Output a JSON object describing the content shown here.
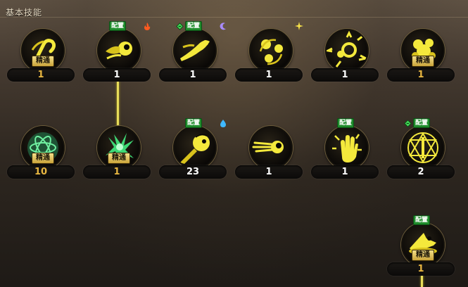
{
  "panel": {
    "title": "基本技能"
  },
  "labels": {
    "mastery": "精通",
    "equip": "配置"
  },
  "colors": {
    "level_gold": "#e9b741",
    "level_white": "#ffffff",
    "equip_badge": "#1f8c2c",
    "connector": "#e8dd5a"
  },
  "skills": [
    {
      "level": "1",
      "gold": true,
      "mastery": true,
      "equip": false,
      "cmd": false,
      "elem": null,
      "icon": "hand-spiral-icon"
    },
    {
      "level": "1",
      "gold": false,
      "mastery": false,
      "equip": true,
      "cmd": false,
      "elem": "fire",
      "icon": "fireball-icon"
    },
    {
      "level": "1",
      "gold": false,
      "mastery": false,
      "equip": true,
      "cmd": true,
      "elem": "dark",
      "icon": "spirit-dash-icon"
    },
    {
      "level": "1",
      "gold": false,
      "mastery": false,
      "equip": false,
      "cmd": false,
      "elem": "light",
      "icon": "triple-orb-icon"
    },
    {
      "level": "1",
      "gold": false,
      "mastery": false,
      "equip": false,
      "cmd": false,
      "elem": null,
      "icon": "burst-ring-icon"
    },
    {
      "level": "1",
      "gold": true,
      "mastery": true,
      "equip": false,
      "cmd": false,
      "elem": null,
      "icon": "explosion-icon"
    },
    {
      "level": "10",
      "gold": true,
      "mastery": true,
      "equip": false,
      "cmd": false,
      "elem": null,
      "icon": "atom-orbit-icon"
    },
    {
      "level": "1",
      "gold": true,
      "mastery": true,
      "equip": false,
      "cmd": false,
      "elem": null,
      "icon": "green-burst-icon"
    },
    {
      "level": "23",
      "gold": false,
      "mastery": false,
      "equip": true,
      "cmd": false,
      "elem": "water",
      "icon": "magic-missile-icon"
    },
    {
      "level": "1",
      "gold": false,
      "mastery": false,
      "equip": false,
      "cmd": false,
      "elem": null,
      "icon": "speed-shot-icon"
    },
    {
      "level": "1",
      "gold": false,
      "mastery": false,
      "equip": true,
      "cmd": false,
      "elem": null,
      "icon": "palm-burst-icon"
    },
    {
      "level": "2",
      "gold": false,
      "mastery": false,
      "equip": true,
      "cmd": true,
      "elem": null,
      "icon": "magic-circle-icon"
    },
    {
      "level": "1",
      "gold": true,
      "mastery": true,
      "equip": true,
      "cmd": false,
      "elem": null,
      "icon": "witch-hat-icon"
    }
  ]
}
